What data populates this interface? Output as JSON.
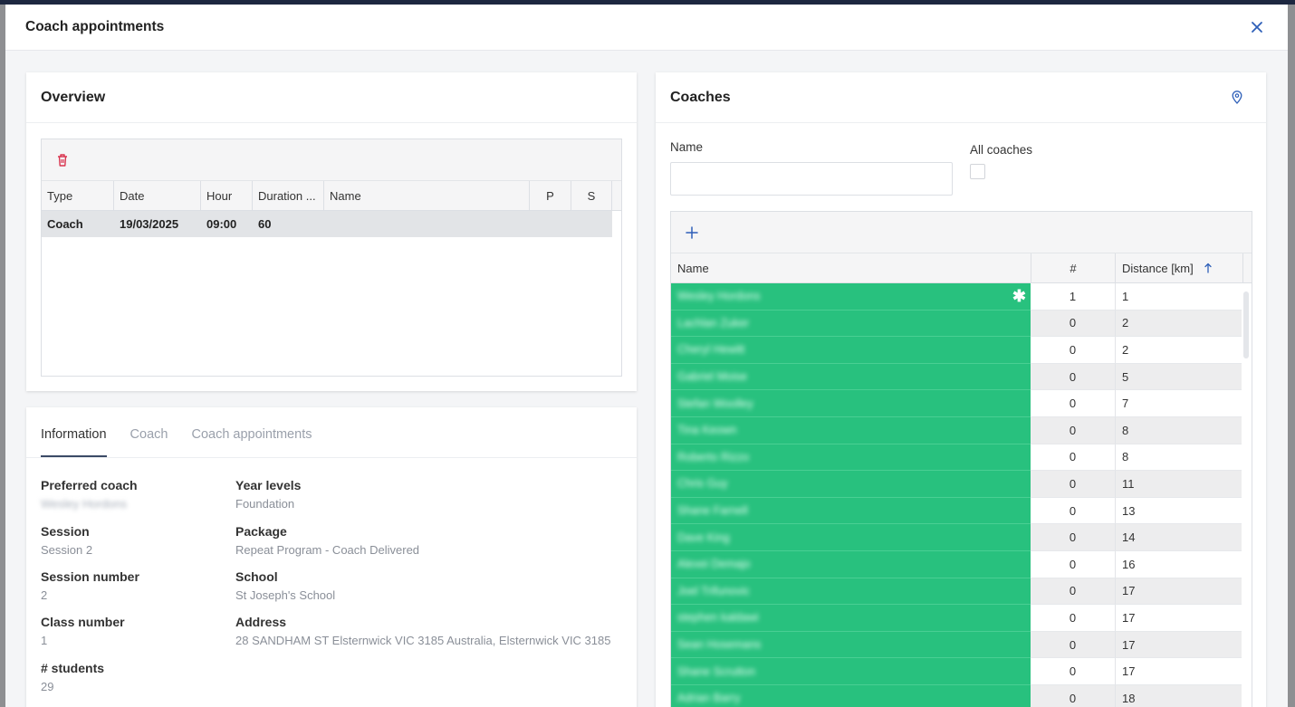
{
  "modal": {
    "title": "Coach appointments"
  },
  "overview": {
    "title": "Overview",
    "columns": [
      "Type",
      "Date",
      "Hour",
      "Duration ...",
      "Name",
      "P",
      "S"
    ],
    "rows": [
      {
        "type": "Coach",
        "date": "19/03/2025",
        "hour": "09:00",
        "duration": "60",
        "name": "",
        "p": "",
        "s": ""
      }
    ]
  },
  "info": {
    "tabs": [
      "Information",
      "Coach",
      "Coach appointments"
    ],
    "active_tab": "Information",
    "fields": {
      "preferred_coach": {
        "label": "Preferred coach",
        "value": "Wesley Hordons"
      },
      "session": {
        "label": "Session",
        "value": "Session 2"
      },
      "session_number": {
        "label": "Session number",
        "value": "2"
      },
      "class_number": {
        "label": "Class number",
        "value": "1"
      },
      "students": {
        "label": "# students",
        "value": "29"
      },
      "year_levels": {
        "label": "Year levels",
        "value": "Foundation"
      },
      "package": {
        "label": "Package",
        "value": "Repeat Program - Coach Delivered"
      },
      "school": {
        "label": "School",
        "value": "St Joseph's School"
      },
      "address": {
        "label": "Address",
        "value": "28 SANDHAM ST Elsternwick VIC 3185 Australia, Elsternwick VIC 3185"
      }
    }
  },
  "coaches": {
    "title": "Coaches",
    "name_label": "Name",
    "name_value": "",
    "all_coaches_label": "All coaches",
    "all_coaches_checked": false,
    "columns": {
      "name": "Name",
      "count": "#",
      "distance": "Distance [km]"
    },
    "sort": {
      "column": "distance",
      "direction": "ascending"
    },
    "rows": [
      {
        "name": "Wesley Hordons",
        "count": "1",
        "distance": "1",
        "starred": true
      },
      {
        "name": "Lachlan Zuker",
        "count": "0",
        "distance": "2"
      },
      {
        "name": "Cheryl Hewitt",
        "count": "0",
        "distance": "2"
      },
      {
        "name": "Gabriel Moise",
        "count": "0",
        "distance": "5"
      },
      {
        "name": "Stefan Woolley",
        "count": "0",
        "distance": "7"
      },
      {
        "name": "Tina Keown",
        "count": "0",
        "distance": "8"
      },
      {
        "name": "Roberto Rizzo",
        "count": "0",
        "distance": "8"
      },
      {
        "name": "Chris Guy",
        "count": "0",
        "distance": "11"
      },
      {
        "name": "Shane Farnell",
        "count": "0",
        "distance": "13"
      },
      {
        "name": "Dave King",
        "count": "0",
        "distance": "14"
      },
      {
        "name": "Alexei Demajo",
        "count": "0",
        "distance": "16"
      },
      {
        "name": "Joel Trifunovic",
        "count": "0",
        "distance": "17"
      },
      {
        "name": "stephen kaldawi",
        "count": "0",
        "distance": "17"
      },
      {
        "name": "Sean Hosemans",
        "count": "0",
        "distance": "17"
      },
      {
        "name": "Shane Scrutton",
        "count": "0",
        "distance": "17"
      },
      {
        "name": "Adrian Barry",
        "count": "0",
        "distance": "18"
      }
    ]
  },
  "colors": {
    "accent": "#2e5fb8",
    "row_highlight": "#28c17e",
    "delete": "#d9344f"
  }
}
